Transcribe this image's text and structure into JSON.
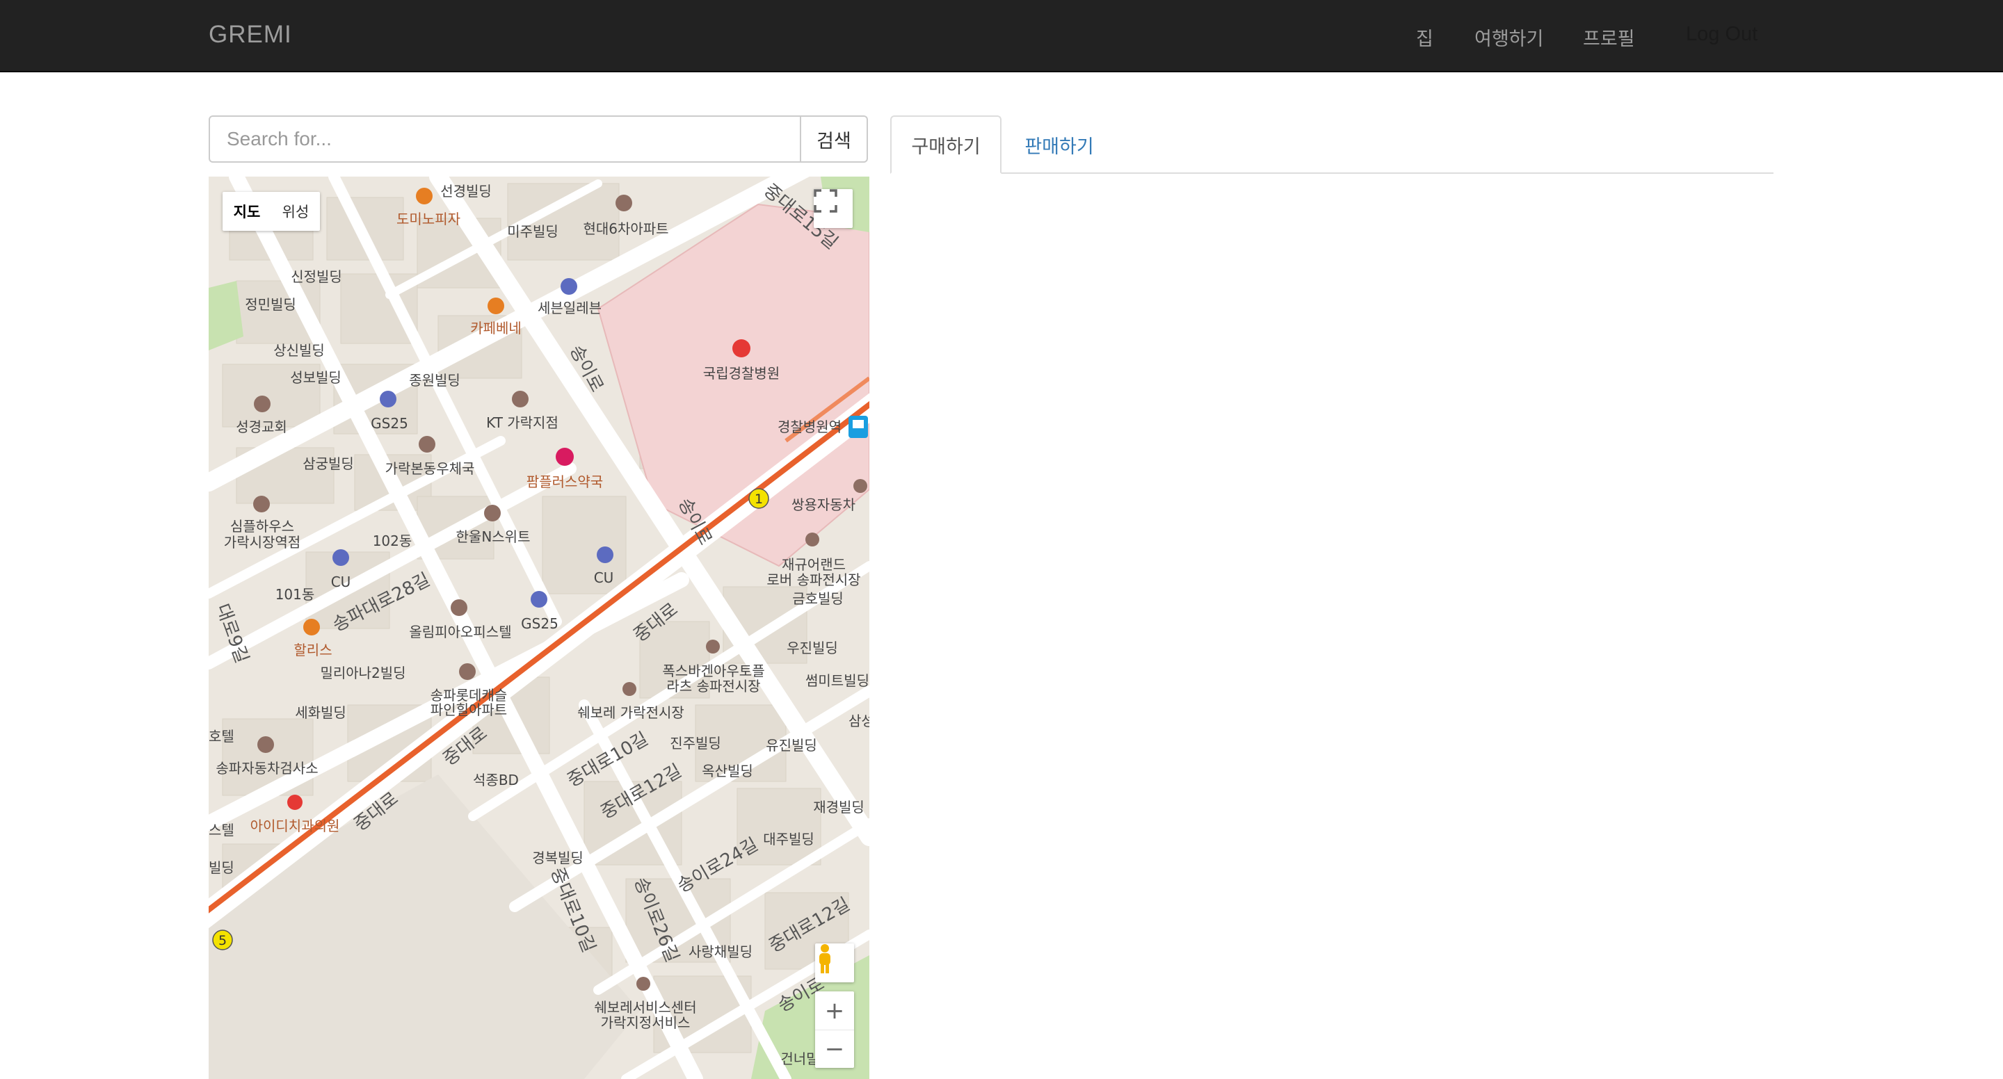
{
  "navbar": {
    "brand": "GREMI",
    "links": [
      "집",
      "여행하기",
      "프로필",
      "Log Out"
    ]
  },
  "search": {
    "placeholder": "Search for...",
    "button_label": "검색"
  },
  "tabs": [
    {
      "label": "구매하기",
      "active": true
    },
    {
      "label": "판매하기",
      "active": false
    }
  ],
  "map": {
    "type_control": {
      "map": "지도",
      "satellite": "위성"
    },
    "zoom_in": "+",
    "zoom_out": "−",
    "places": {
      "p1": "선경빌딩",
      "p2": "도미노피자",
      "p3": "미주빌딩",
      "p4": "현대6차아파트",
      "p5": "신정빌딩",
      "p6": "정민빌딩",
      "p7": "세븐일레븐",
      "p8": "카페베네",
      "p9": "상신빌딩",
      "p10": "성보빌딩",
      "p11": "종원빌딩",
      "p12": "국립경찰병원",
      "p13": "성경교회",
      "p14": "GS25",
      "p15": "KT 가락지점",
      "p16": "경찰병원역",
      "p17": "삼궁빌딩",
      "p18": "가락본동우체국",
      "p19": "팜플러스약국",
      "p20": "쌍용자동차",
      "p21": "심플하우스",
      "p22": "가락시장역점",
      "p23": "102동",
      "p24": "한울N스위트",
      "p25": "재규어랜드",
      "p26": "로버 송파전시장",
      "p27": "CU",
      "p28": "CU",
      "p29": "금호빌딩",
      "p30": "101동",
      "p31": "GS25",
      "p32": "올림피아오피스텔",
      "p33": "우진빌딩",
      "p34": "할리스",
      "p35": "폭스바겐아우토플",
      "p36": "라츠 송파전시장",
      "p37": "썸미트빌딩",
      "p38": "밀리아나2빌딩",
      "p39": "송파롯데캐슬",
      "p40": "파인힐아파트",
      "p41": "세화빌딩",
      "p42": "쉐보레 가락전시장",
      "p43": "진주빌딩",
      "p44": "유진빌딩",
      "p45": "송파자동차검사소",
      "p46": "석종BD",
      "p47": "옥산빌딩",
      "p48": "아이디치과의원",
      "p49": "재경빌딩",
      "p50": "경복빌딩",
      "p51": "대주빌딩",
      "p52": "사랑채빌딩",
      "p53": "쉐보레서비스센터",
      "p54": "가락지정서비스",
      "p55": "건너말",
      "p56": "삼성빌",
      "p57": "호텔",
      "p58": "스텔",
      "p59": "빌딩"
    },
    "roads": {
      "r1": "중대로15길",
      "r2": "송이로",
      "r3": "송이로",
      "r4": "송파대로28길",
      "r5": "중대로",
      "r6": "중대로",
      "r7": "중대로",
      "r8": "중대로10길",
      "r9": "중대로12길",
      "r10": "송이로24길",
      "r11": "중대로10길",
      "r12": "송이로26길",
      "r13": "중대로12길",
      "r14": "송이로",
      "r15": "대로9길"
    },
    "line_markers": [
      "1",
      "5"
    ],
    "colors": {
      "background": "#ece7df",
      "road": "#ffffff",
      "subway_line": "#e8612c",
      "hospital_area": "#f3d3d3",
      "park": "#c8e2b0",
      "poi_orange": "#b0592c"
    }
  }
}
